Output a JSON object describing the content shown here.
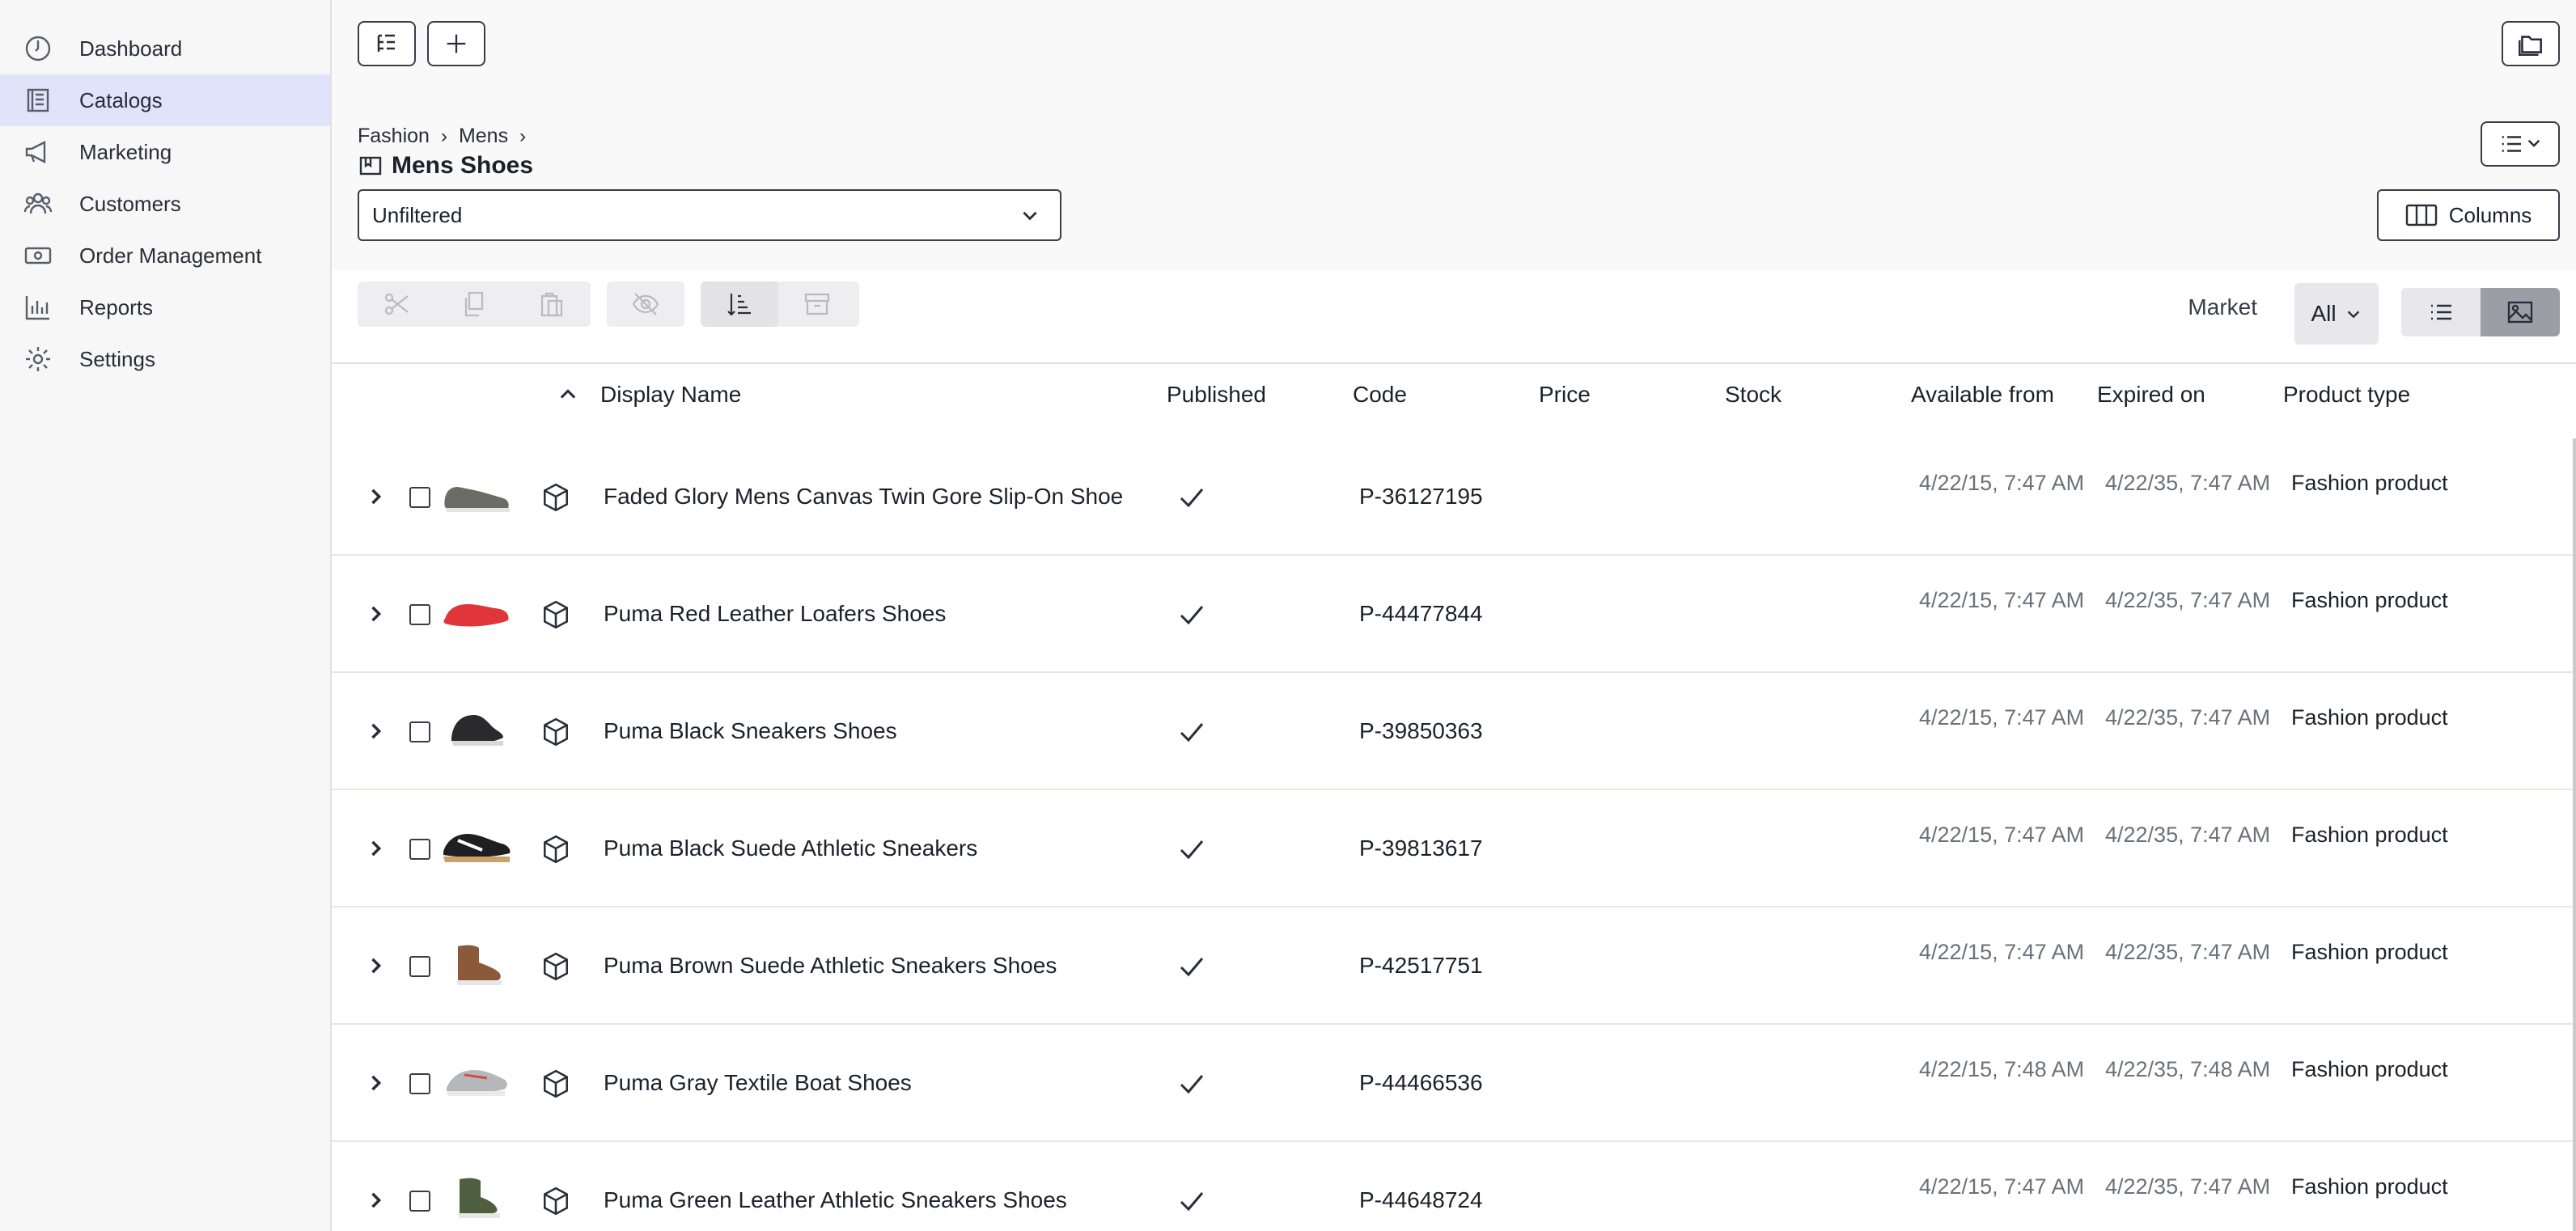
{
  "sidebar": {
    "items": [
      {
        "label": "Dashboard",
        "icon": "dashboard-icon"
      },
      {
        "label": "Catalogs",
        "icon": "catalog-icon",
        "active": true
      },
      {
        "label": "Marketing",
        "icon": "megaphone-icon"
      },
      {
        "label": "Customers",
        "icon": "users-icon"
      },
      {
        "label": "Order Management",
        "icon": "money-icon"
      },
      {
        "label": "Reports",
        "icon": "bar-chart-icon"
      },
      {
        "label": "Settings",
        "icon": "gear-icon"
      }
    ]
  },
  "header": {
    "breadcrumb": [
      "Fashion",
      "Mens"
    ],
    "title": "Mens Shoes",
    "filter_value": "Unfiltered",
    "columns_label": "Columns"
  },
  "toolbar": {
    "market_label": "Market",
    "market_value": "All"
  },
  "table": {
    "columns": [
      "Display Name",
      "Published",
      "Code",
      "Price",
      "Stock",
      "Available from",
      "Expired on",
      "Product type"
    ],
    "rows": [
      {
        "name": "Faded Glory Mens Canvas Twin Gore Slip-On Shoe",
        "code": "P-36127195",
        "available_from": "4/22/15, 7:47 AM",
        "expired_on": "4/22/35, 7:47 AM",
        "product_type": "Fashion product",
        "shoe_color": "#6b6c66"
      },
      {
        "name": "Puma Red Leather Loafers Shoes",
        "code": "P-44477844",
        "available_from": "4/22/15, 7:47 AM",
        "expired_on": "4/22/35, 7:47 AM",
        "product_type": "Fashion product",
        "shoe_color": "#e0363a"
      },
      {
        "name": "Puma Black Sneakers Shoes",
        "code": "P-39850363",
        "available_from": "4/22/15, 7:47 AM",
        "expired_on": "4/22/35, 7:47 AM",
        "product_type": "Fashion product",
        "shoe_color": "#2a2a2c"
      },
      {
        "name": "Puma Black Suede Athletic Sneakers",
        "code": "P-39813617",
        "available_from": "4/22/15, 7:47 AM",
        "expired_on": "4/22/35, 7:47 AM",
        "product_type": "Fashion product",
        "shoe_color": "#1f1f22"
      },
      {
        "name": "Puma Brown Suede Athletic Sneakers Shoes",
        "code": "P-42517751",
        "available_from": "4/22/15, 7:47 AM",
        "expired_on": "4/22/35, 7:47 AM",
        "product_type": "Fashion product",
        "shoe_color": "#8a5a3a"
      },
      {
        "name": "Puma Gray Textile Boat Shoes",
        "code": "P-44466536",
        "available_from": "4/22/15, 7:48 AM",
        "expired_on": "4/22/35, 7:48 AM",
        "product_type": "Fashion product",
        "shoe_color": "#b5b7ba"
      },
      {
        "name": "Puma Green Leather Athletic Sneakers Shoes",
        "code": "P-44648724",
        "available_from": "4/22/15, 7:47 AM",
        "expired_on": "4/22/35, 7:47 AM",
        "product_type": "Fashion product",
        "shoe_color": "#4f5e3e"
      }
    ]
  }
}
